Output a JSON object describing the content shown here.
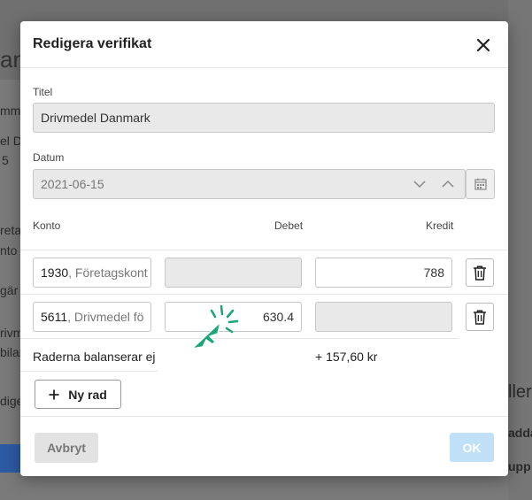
{
  "background": {
    "title_fragment": "an",
    "left_fragments": [
      "mm",
      "el Da",
      "5",
      "reta",
      "nto",
      "gär",
      "rivm",
      "bilar",
      "dige"
    ],
    "right_fragments": [
      "ller",
      "adda",
      "upp"
    ]
  },
  "modal": {
    "title": "Redigera verifikat",
    "title_label": "Titel",
    "title_value": "Drivmedel Danmark",
    "date_label": "Datum",
    "date_value": "2021-06-15",
    "columns": {
      "konto": "Konto",
      "debet": "Debet",
      "kredit": "Kredit"
    },
    "rows": [
      {
        "konto_number": "1930",
        "konto_name": ", Företagskont",
        "debet": "",
        "kredit": "788"
      },
      {
        "konto_number": "5611",
        "konto_name": ", Drivmedel fö",
        "debet": "630.4",
        "kredit": ""
      }
    ],
    "balance_text": "Raderna balanserar ej",
    "balance_diff": "+ 157,60 kr",
    "new_row_label": "Ny rad",
    "cancel_label": "Avbryt",
    "ok_label": "OK"
  },
  "colors": {
    "accent_cursor": "#1aa57a",
    "ok_disabled": "#bfe0f7"
  },
  "icons": [
    "close-icon",
    "chevron-down-icon",
    "chevron-up-icon",
    "calendar-icon",
    "trash-icon",
    "plus-icon",
    "click-cursor-icon"
  ]
}
